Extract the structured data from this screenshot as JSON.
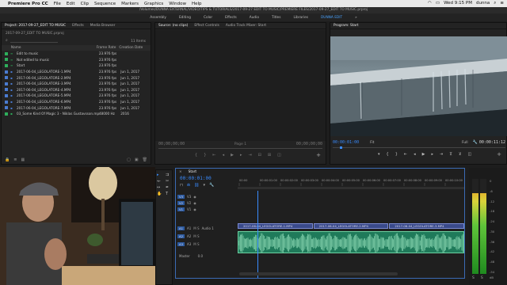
{
  "menubar": {
    "app_name": "Premiere Pro CC",
    "items": [
      "File",
      "Edit",
      "Clip",
      "Sequence",
      "Markers",
      "Graphics",
      "Window",
      "Help"
    ],
    "clock": "Wed 9:15 PM",
    "user": "dunna"
  },
  "titlebar": {
    "path": "/Volumes/DUNNA EXTERNAL/VIDEO/TIPS & TUTORIALS/2017-09-27 EDIT TO MUSIC/PREMIERE FILES/2017-09-27_EDIT TO MUSIC.prproj"
  },
  "workspaces": [
    {
      "label": "Assembly",
      "active": false
    },
    {
      "label": "Editing",
      "active": false
    },
    {
      "label": "Color",
      "active": false
    },
    {
      "label": "Effects",
      "active": false
    },
    {
      "label": "Audio",
      "active": false
    },
    {
      "label": "Titles",
      "active": false
    },
    {
      "label": "Libraries",
      "active": false
    },
    {
      "label": "DUNNA EDIT",
      "active": true
    }
  ],
  "project_panel": {
    "tabs": [
      "Project: 2017-09-27_EDIT TO MUSIC",
      "Effects",
      "Media Browser"
    ],
    "file": "2017-09-27_EDIT TO MUSIC.prproj",
    "item_count": "11 Items",
    "columns": [
      "Name",
      "Frame Rate",
      "Creation Date"
    ],
    "rows": [
      {
        "name": "Edit to music",
        "fps": "23.976 fps",
        "date": "",
        "color": "#2eae5b",
        "indent": true
      },
      {
        "name": "Not edited to music",
        "fps": "23.976 fps",
        "date": "",
        "color": "#2eae5b",
        "indent": true
      },
      {
        "name": "Start",
        "fps": "23.976 fps",
        "date": "",
        "color": "#2eae5b",
        "indent": true
      },
      {
        "name": "2017-06-04_LEGOLATORE-1.MP4",
        "fps": "23.976 fps",
        "date": "Jun 1, 2017",
        "color": "#4a7bd0",
        "indent": false
      },
      {
        "name": "2017-06-04_LEGOLATORE-2.MP4",
        "fps": "23.976 fps",
        "date": "Jun 1, 2017",
        "color": "#4a7bd0",
        "indent": false
      },
      {
        "name": "2017-06-04_LEGOLATORE-3.MP4",
        "fps": "23.976 fps",
        "date": "Jun 1, 2017",
        "color": "#4a7bd0",
        "indent": false
      },
      {
        "name": "2017-06-04_LEGOLATORE-4.MP4",
        "fps": "23.976 fps",
        "date": "Jun 1, 2017",
        "color": "#4a7bd0",
        "indent": false
      },
      {
        "name": "2017-06-04_LEGOLATORE-5.MP4",
        "fps": "23.976 fps",
        "date": "Jun 1, 2017",
        "color": "#4a7bd0",
        "indent": false
      },
      {
        "name": "2017-06-04_LEGOLATORE-6.MP4",
        "fps": "23.976 fps",
        "date": "Jun 1, 2017",
        "color": "#4a7bd0",
        "indent": false
      },
      {
        "name": "2017-06-04_LEGOLATORE-7.MP4",
        "fps": "23.976 fps",
        "date": "Jun 1, 2017",
        "color": "#4a7bd0",
        "indent": false
      },
      {
        "name": "03_Some Kind Of Magic 3 - Niklas Gustavsson.mp3",
        "fps": "48000 Hz",
        "date": "2016",
        "color": "#2eae5b",
        "indent": false
      }
    ]
  },
  "source_panel": {
    "tabs": [
      "Source: (no clips)",
      "Effect Controls",
      "Audio Track Mixer: Start"
    ],
    "timecode_left": "00;00;00;00",
    "page": "Page 1",
    "timecode_right": "00;00;00;00"
  },
  "program_panel": {
    "tab": "Program: Start",
    "timecode": "00:00:01:00",
    "fit": "Fit",
    "quality": "Full",
    "duration": "00:00:11:12"
  },
  "timeline": {
    "tab": "Start",
    "timecode": "00:00:01:00",
    "ruler": [
      "00:00",
      "00:00:01:00",
      "00:00:02:00",
      "00:00:03:00",
      "00:00:04:00",
      "00:00:05:00",
      "00:00:06:00",
      "00:00:07:00",
      "00:00:08:00",
      "00:00:09:00",
      "00:00:10:00"
    ],
    "tracks": {
      "video": [
        "V3",
        "V2",
        "V1"
      ],
      "audio": [
        "A1",
        "A2",
        "A3"
      ],
      "master": "Master",
      "master_value": "0.0"
    },
    "audio_track_label": "Audio 1",
    "clips_video": [
      {
        "label": "2017-06-04_LEGOLATORE-1.MP4"
      },
      {
        "label": "2017-06-04_LEGOLATORE-2.MP4"
      },
      {
        "label": "2017-06-04_LEGOLATORE-3.MP4"
      }
    ]
  },
  "meters": {
    "labels": [
      "0",
      "-6",
      "-12",
      "-18",
      "-24",
      "-30",
      "-36",
      "-42",
      "-48",
      "-54"
    ],
    "unit": "dB",
    "solo": "S"
  }
}
